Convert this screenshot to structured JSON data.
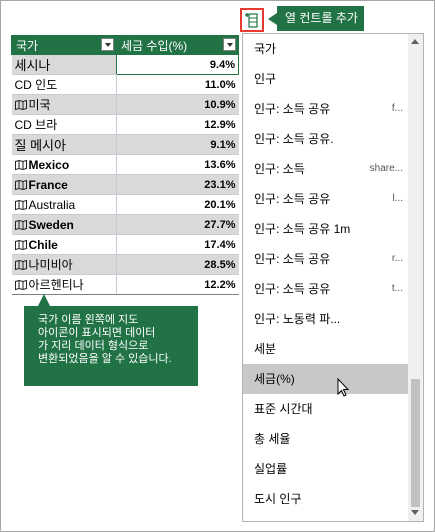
{
  "table": {
    "headers": [
      "국가",
      "세금 수입(%)"
    ],
    "rows": [
      {
        "name": "세시나",
        "value": "9.4%",
        "icon": "",
        "style": "big",
        "shade": true,
        "selected": true
      },
      {
        "name": "CD 인도",
        "value": "11.0%",
        "icon": "",
        "style": "",
        "shade": false,
        "selected": false
      },
      {
        "name": "미국",
        "value": "10.9%",
        "icon": "map-icon",
        "style": "",
        "shade": true,
        "selected": false
      },
      {
        "name": "CD 브라",
        "value": "12.9%",
        "icon": "",
        "style": "",
        "shade": false,
        "selected": false
      },
      {
        "name": "질 메시아",
        "value": "9.1%",
        "icon": "",
        "style": "big",
        "shade": true,
        "selected": false
      },
      {
        "name": "Mexico",
        "value": "13.6%",
        "icon": "map-icon",
        "style": "bold",
        "shade": false,
        "selected": false
      },
      {
        "name": "France",
        "value": "23.1%",
        "icon": "map-icon",
        "style": "bold",
        "shade": true,
        "selected": false
      },
      {
        "name": "Australia",
        "value": "20.1%",
        "icon": "map-icon",
        "style": "",
        "shade": false,
        "selected": false
      },
      {
        "name": "Sweden",
        "value": "27.7%",
        "icon": "map-icon",
        "style": "bold",
        "shade": true,
        "selected": false
      },
      {
        "name": "Chile",
        "value": "17.4%",
        "icon": "map-icon",
        "style": "bold",
        "shade": false,
        "selected": false
      },
      {
        "name": "나미비아",
        "value": "28.5%",
        "icon": "map-icon",
        "style": "",
        "shade": true,
        "selected": false
      },
      {
        "name": "아르헨티나",
        "value": "12.2%",
        "icon": "map-icon",
        "style": "",
        "shade": false,
        "selected": false
      }
    ]
  },
  "callout": {
    "lines": [
      "국가 이름 왼쪽에 지도",
      "아이콘이 표시되면 데이터",
      "가 지리 데이터 형식으로",
      "변환되었음을 알 수 있습니다."
    ]
  },
  "add_column": {
    "tooltip": "열 컨트롤 추가",
    "icon": "add-column-icon"
  },
  "field_list": {
    "items": [
      {
        "label": "국가",
        "extra": ""
      },
      {
        "label": "인구",
        "extra": ""
      },
      {
        "label": "인구: 소득 공유",
        "extra": "f..."
      },
      {
        "label": "인구: 소득 공유.",
        "extra": ""
      },
      {
        "label": "인구: 소득",
        "extra": "share..."
      },
      {
        "label": "인구: 소득 공유",
        "extra": "l..."
      },
      {
        "label": "인구: 소득 공유 1m",
        "extra": ""
      },
      {
        "label": "인구: 소득 공유",
        "extra": "r..."
      },
      {
        "label": "인구: 소득 공유",
        "extra": "t..."
      },
      {
        "label": "인구: 노동력 파...",
        "extra": ""
      },
      {
        "label": "세분",
        "extra": ""
      },
      {
        "label": "세금(%)",
        "extra": ""
      },
      {
        "label": "표준 시간대",
        "extra": ""
      },
      {
        "label": "총 세율",
        "extra": ""
      },
      {
        "label": "실업률",
        "extra": ""
      },
      {
        "label": "도시 인구",
        "extra": ""
      }
    ],
    "highlighted_index": 11
  },
  "colors": {
    "accent": "#217346",
    "highlight_border": "#e83a2f"
  }
}
